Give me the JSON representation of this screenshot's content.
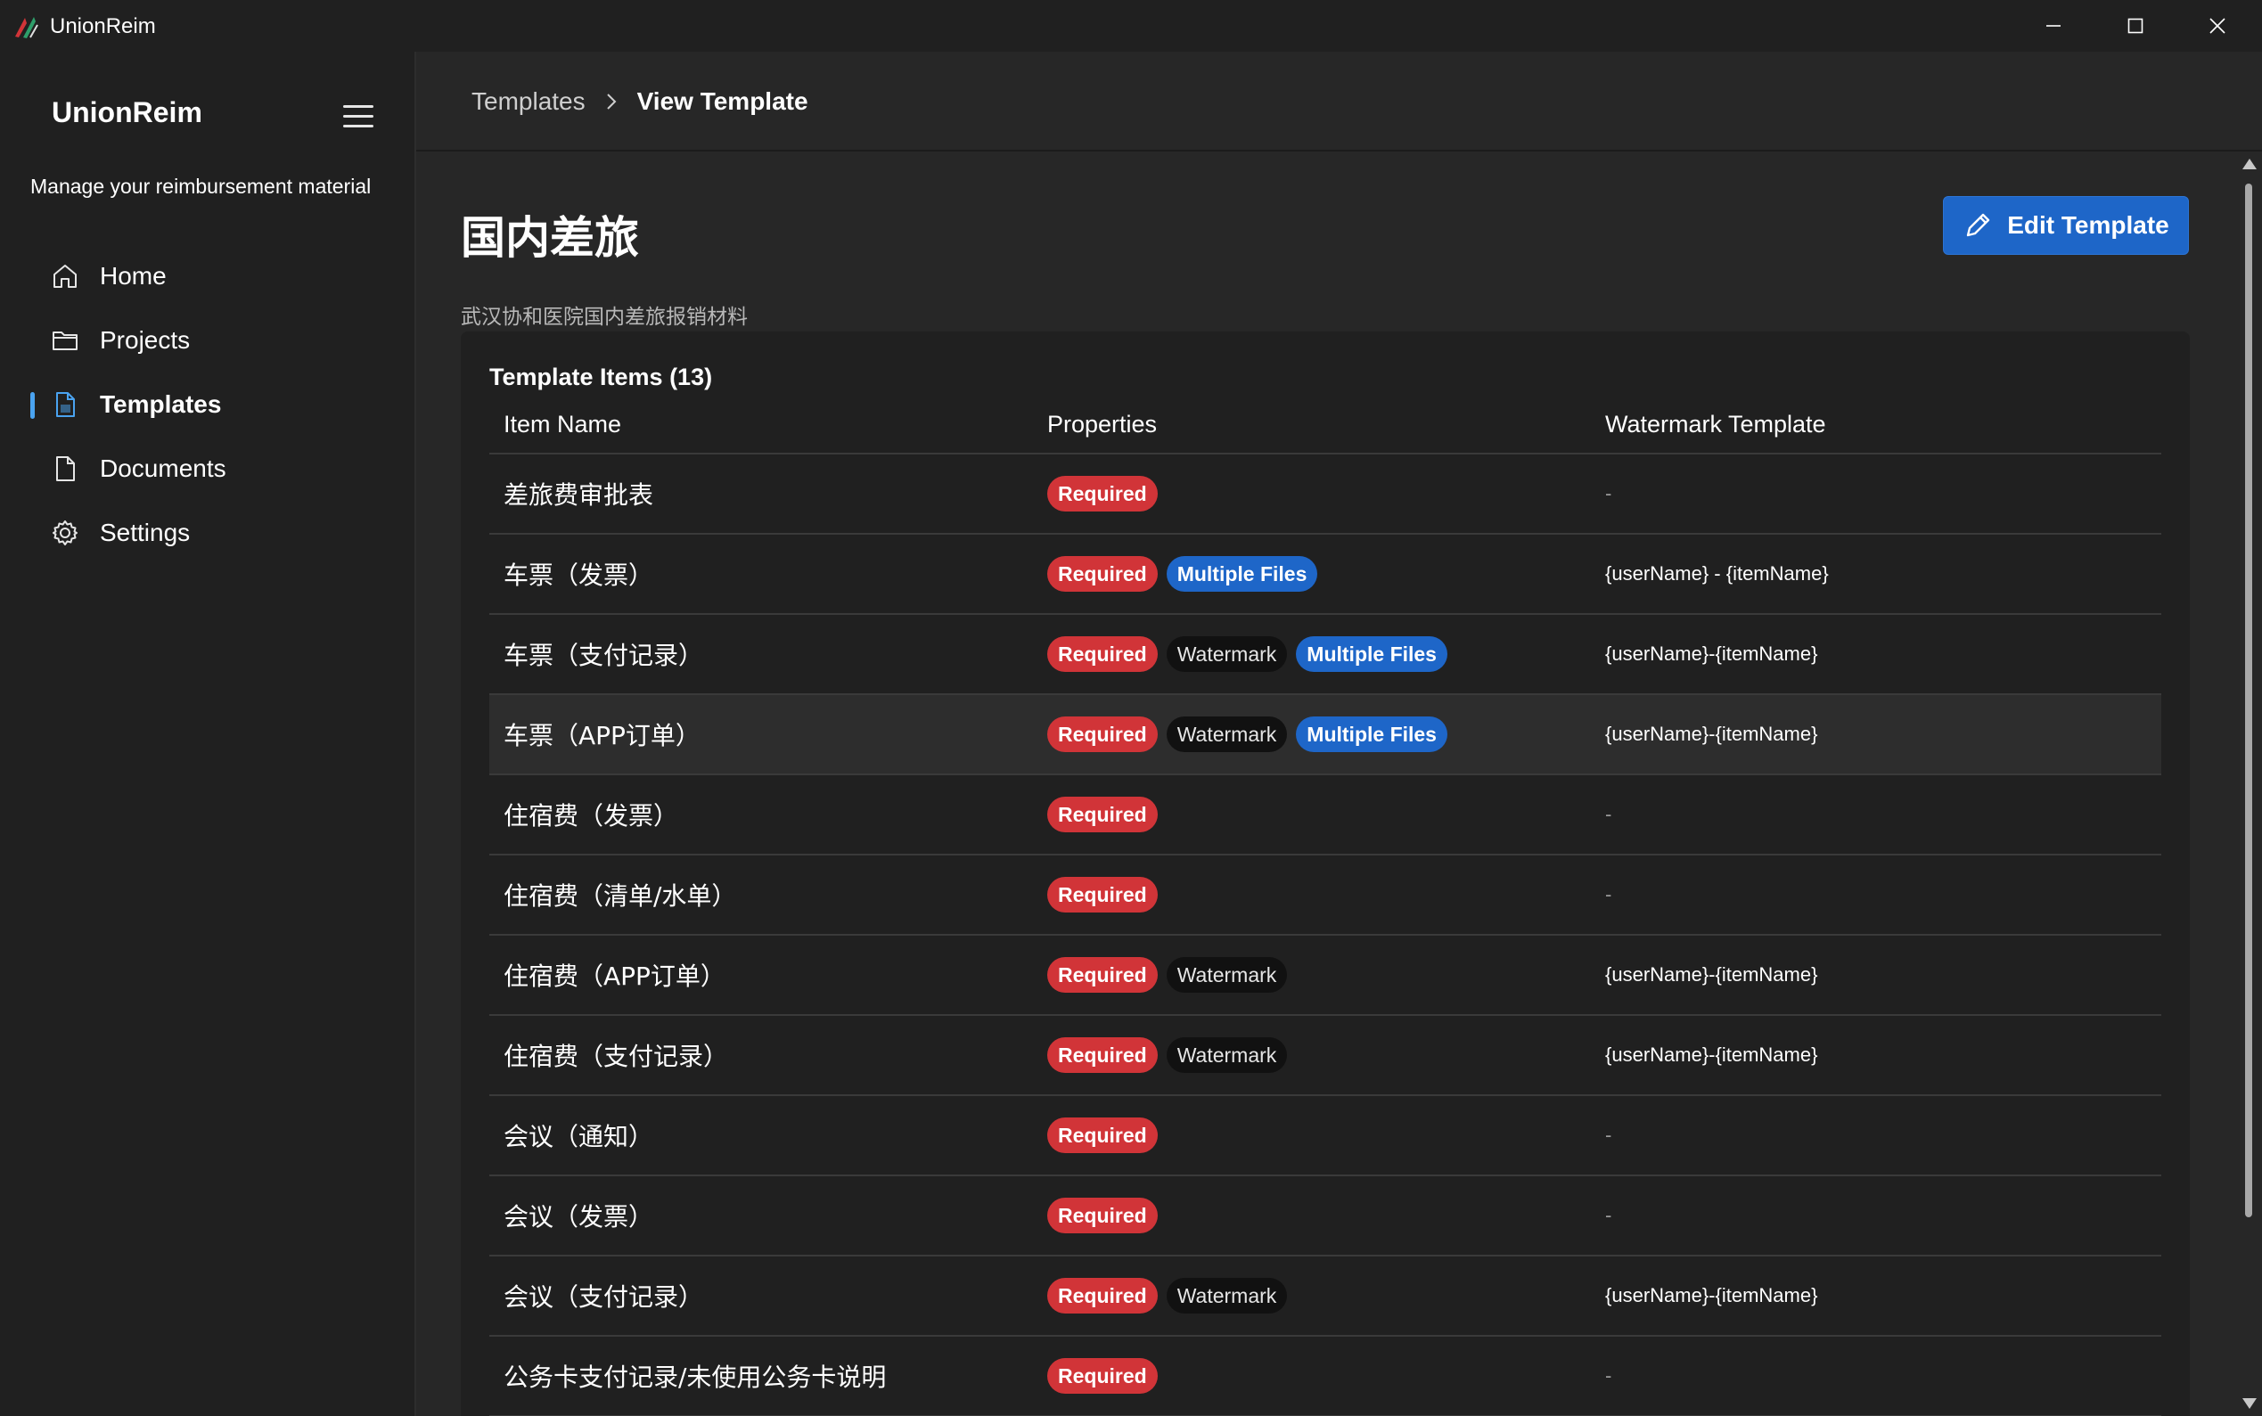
{
  "window": {
    "title": "UnionReim"
  },
  "sidebar": {
    "title": "UnionReim",
    "subtitle": "Manage your reimbursement material",
    "items": [
      {
        "label": "Home",
        "icon": "home-icon",
        "active": false
      },
      {
        "label": "Projects",
        "icon": "folder-icon",
        "active": false
      },
      {
        "label": "Templates",
        "icon": "document-icon",
        "active": true
      },
      {
        "label": "Documents",
        "icon": "document-icon",
        "active": false
      },
      {
        "label": "Settings",
        "icon": "gear-icon",
        "active": false
      }
    ]
  },
  "breadcrumb": {
    "parent": "Templates",
    "current": "View Template"
  },
  "page": {
    "title": "国内差旅",
    "description": "武汉协和医院国内差旅报销材料",
    "edit_button": "Edit Template"
  },
  "table": {
    "title": "Template Items (13)",
    "columns": [
      "Item Name",
      "Properties",
      "Watermark Template"
    ],
    "rows": [
      {
        "name": "差旅费审批表",
        "badges": [
          "Required"
        ],
        "watermark": "-"
      },
      {
        "name": "车票（发票）",
        "badges": [
          "Required",
          "Multiple Files"
        ],
        "watermark": "{userName} - {itemName}"
      },
      {
        "name": "车票（支付记录）",
        "badges": [
          "Required",
          "Watermark",
          "Multiple Files"
        ],
        "watermark": "{userName}-{itemName}"
      },
      {
        "name": "车票（APP订单）",
        "badges": [
          "Required",
          "Watermark",
          "Multiple Files"
        ],
        "watermark": "{userName}-{itemName}",
        "hover": true
      },
      {
        "name": "住宿费（发票）",
        "badges": [
          "Required"
        ],
        "watermark": "-"
      },
      {
        "name": "住宿费（清单/水单）",
        "badges": [
          "Required"
        ],
        "watermark": "-"
      },
      {
        "name": "住宿费（APP订单）",
        "badges": [
          "Required",
          "Watermark"
        ],
        "watermark": "{userName}-{itemName}"
      },
      {
        "name": "住宿费（支付记录）",
        "badges": [
          "Required",
          "Watermark"
        ],
        "watermark": "{userName}-{itemName}"
      },
      {
        "name": "会议（通知）",
        "badges": [
          "Required"
        ],
        "watermark": "-"
      },
      {
        "name": "会议（发票）",
        "badges": [
          "Required"
        ],
        "watermark": "-"
      },
      {
        "name": "会议（支付记录）",
        "badges": [
          "Required",
          "Watermark"
        ],
        "watermark": "{userName}-{itemName}"
      },
      {
        "name": "公务卡支付记录/未使用公务卡说明",
        "badges": [
          "Required"
        ],
        "watermark": "-"
      }
    ]
  },
  "colors": {
    "accent": "#1e66c8",
    "required": "#d13438",
    "watermark_badge": "#111111",
    "nav_indicator": "#4aa3f0"
  }
}
